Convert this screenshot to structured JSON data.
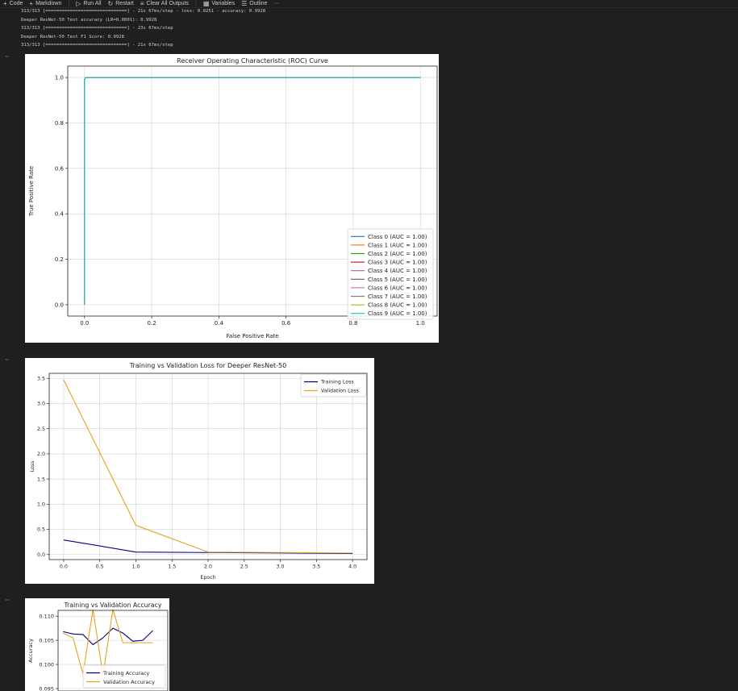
{
  "toolbar": {
    "items": [
      {
        "icon": "plus-icon",
        "glyph": "+",
        "label": "Code"
      },
      {
        "icon": "plus-icon",
        "glyph": "+",
        "label": "Markdown"
      },
      {
        "icon": "run-all-icon",
        "glyph": "▷",
        "label": "Run All"
      },
      {
        "icon": "restart-icon",
        "glyph": "↻",
        "label": "Restart"
      },
      {
        "icon": "clear-outputs-icon",
        "glyph": "≡",
        "label": "Clear All Outputs"
      },
      {
        "icon": "variables-icon",
        "glyph": "▦",
        "label": "Variables"
      },
      {
        "icon": "outline-icon",
        "glyph": "☰",
        "label": "Outline"
      }
    ],
    "more": "···"
  },
  "output_lines": [
    "313/313 [==============================] - 21s 67ms/step - loss: 0.0251 - accuracy: 0.9928",
    "Deeper ResNet-50 Test accuracy (LR=0.0001): 0.9928",
    "313/313 [==============================] - 23s 67ms/step",
    "Deeper ResNet-50 Test F1 Score: 0.9928",
    "313/313 [==============================] - 21s 67ms/step"
  ],
  "cell_menu": "···",
  "chart_data": [
    {
      "type": "line",
      "title": "Receiver Operating Characteristic (ROC) Curve",
      "xlabel": "False Positive Rate",
      "ylabel": "True Positive Rate",
      "xlim": [
        -0.05,
        1.05
      ],
      "ylim": [
        -0.05,
        1.05
      ],
      "xticks": [
        0.0,
        0.2,
        0.4,
        0.6,
        0.8,
        1.0
      ],
      "yticks": [
        0.0,
        0.2,
        0.4,
        0.6,
        0.8,
        1.0
      ],
      "tick_decimals": 1,
      "grid": true,
      "legend_position": "lower-right",
      "series": [
        {
          "name": "Class 0 (AUC = 1.00)",
          "color": "#1f77b4",
          "x": [
            0,
            0,
            0.003,
            1
          ],
          "y": [
            0,
            0.99,
            1,
            1
          ]
        },
        {
          "name": "Class 1 (AUC = 1.00)",
          "color": "#ff7f0e",
          "x": [
            0,
            0,
            0.003,
            1
          ],
          "y": [
            0,
            0.99,
            1,
            1
          ]
        },
        {
          "name": "Class 2 (AUC = 1.00)",
          "color": "#2ca02c",
          "x": [
            0,
            0,
            0.003,
            1
          ],
          "y": [
            0,
            0.99,
            1,
            1
          ]
        },
        {
          "name": "Class 3 (AUC = 1.00)",
          "color": "#d62728",
          "x": [
            0,
            0,
            0.003,
            1
          ],
          "y": [
            0,
            0.99,
            1,
            1
          ]
        },
        {
          "name": "Class 4 (AUC = 1.00)",
          "color": "#9467bd",
          "x": [
            0,
            0,
            0.003,
            1
          ],
          "y": [
            0,
            0.99,
            1,
            1
          ]
        },
        {
          "name": "Class 5 (AUC = 1.00)",
          "color": "#8c564b",
          "x": [
            0,
            0,
            0.003,
            1
          ],
          "y": [
            0,
            0.99,
            1,
            1
          ]
        },
        {
          "name": "Class 6 (AUC = 1.00)",
          "color": "#e377c2",
          "x": [
            0,
            0,
            0.003,
            1
          ],
          "y": [
            0,
            0.99,
            1,
            1
          ]
        },
        {
          "name": "Class 7 (AUC = 1.00)",
          "color": "#7f7f7f",
          "x": [
            0,
            0,
            0.003,
            1
          ],
          "y": [
            0,
            0.99,
            1,
            1
          ]
        },
        {
          "name": "Class 8 (AUC = 1.00)",
          "color": "#bcbd22",
          "x": [
            0,
            0,
            0.003,
            1
          ],
          "y": [
            0,
            0.99,
            1,
            1
          ]
        },
        {
          "name": "Class 9 (AUC = 1.00)",
          "color": "#17becf",
          "x": [
            0,
            0,
            0.003,
            1
          ],
          "y": [
            0,
            0.99,
            1,
            1
          ]
        }
      ]
    },
    {
      "type": "line",
      "title": "Training vs Validation Loss for Deeper ResNet-50",
      "xlabel": "Epoch",
      "ylabel": "Loss",
      "xlim": [
        -0.2,
        4.2
      ],
      "ylim": [
        -0.1,
        3.6
      ],
      "xticks": [
        0.0,
        0.5,
        1.0,
        1.5,
        2.0,
        2.5,
        3.0,
        3.5,
        4.0
      ],
      "yticks": [
        0.0,
        0.5,
        1.0,
        1.5,
        2.0,
        2.5,
        3.0,
        3.5
      ],
      "tick_decimals": 1,
      "grid": true,
      "legend_position": "upper-right",
      "series": [
        {
          "name": "Training Loss",
          "color": "#00008b",
          "x": [
            0,
            1,
            2,
            3,
            4
          ],
          "y": [
            0.29,
            0.05,
            0.04,
            0.03,
            0.02
          ]
        },
        {
          "name": "Validation Loss",
          "color": "#e6a11f",
          "x": [
            0,
            1,
            2,
            3,
            4
          ],
          "y": [
            3.47,
            0.58,
            0.05,
            0.04,
            0.03
          ]
        }
      ]
    },
    {
      "type": "line",
      "title": "Training vs Validation Accuracy",
      "xlabel": "",
      "ylabel": "Accuracy",
      "xlim": [
        -0.5,
        10.5
      ],
      "ylim": [
        0.0945,
        0.1112
      ],
      "xticks": [],
      "yticks": [
        0.095,
        0.1,
        0.105,
        0.11
      ],
      "tick_decimals": 3,
      "grid": true,
      "legend_position": "lower-center",
      "series": [
        {
          "name": "Training Accuracy",
          "color": "#00008b",
          "x": [
            0,
            1,
            2,
            3,
            4,
            5,
            6,
            7,
            8,
            9
          ],
          "y": [
            0.1068,
            0.1063,
            0.1062,
            0.1041,
            0.1055,
            0.1075,
            0.1065,
            0.1048,
            0.105,
            0.107
          ]
        },
        {
          "name": "Validation Accuracy",
          "color": "#e6a11f",
          "x": [
            0,
            1,
            2,
            3,
            4,
            5,
            6,
            7,
            8,
            9
          ],
          "y": [
            0.1065,
            0.1055,
            0.098,
            0.1114,
            0.0978,
            0.1114,
            0.1045,
            0.1045,
            0.1045,
            0.1045
          ]
        }
      ]
    }
  ]
}
